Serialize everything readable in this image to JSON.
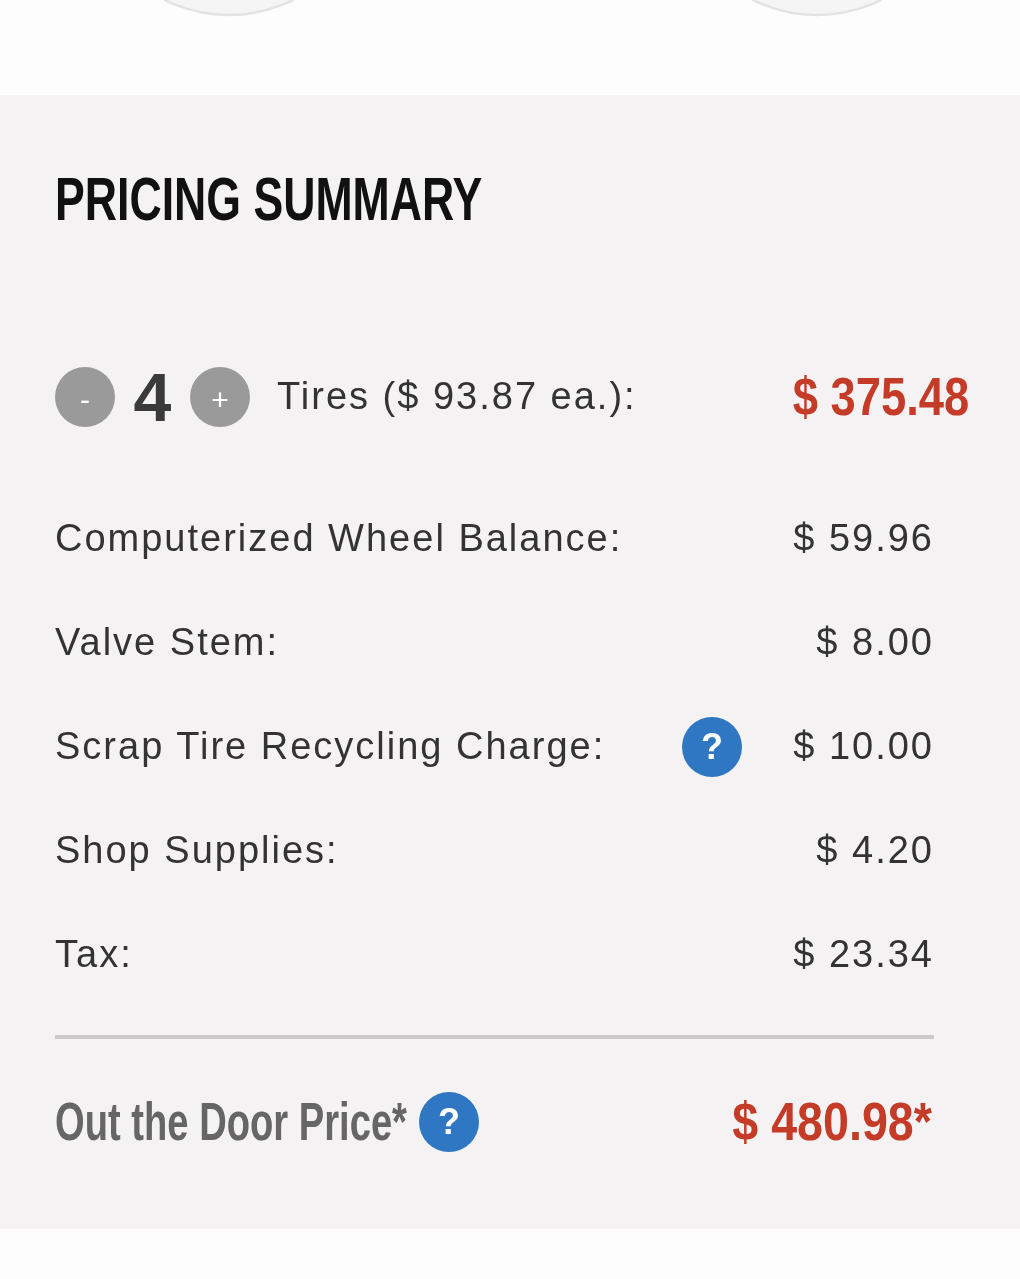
{
  "section_title": "PRICING SUMMARY",
  "tires": {
    "decrement_button": "-",
    "quantity": "4",
    "increment_button": "+",
    "label": "Tires ($ 93.87 ea.):",
    "price": "$ 375.48"
  },
  "charges": [
    {
      "label": "Computerized Wheel Balance:",
      "amount": "$ 59.96"
    },
    {
      "label": "Valve Stem:",
      "amount": "$ 8.00"
    },
    {
      "label": "Scrap Tire Recycling Charge:",
      "help_button": "?",
      "amount": "$ 10.00"
    },
    {
      "label": "Shop Supplies:",
      "amount": "$ 4.20"
    },
    {
      "label": "Tax:",
      "amount": "$ 23.34"
    }
  ],
  "total": {
    "label": "Out the Door Price*",
    "help_button": "?",
    "amount": "$ 480.98*"
  }
}
